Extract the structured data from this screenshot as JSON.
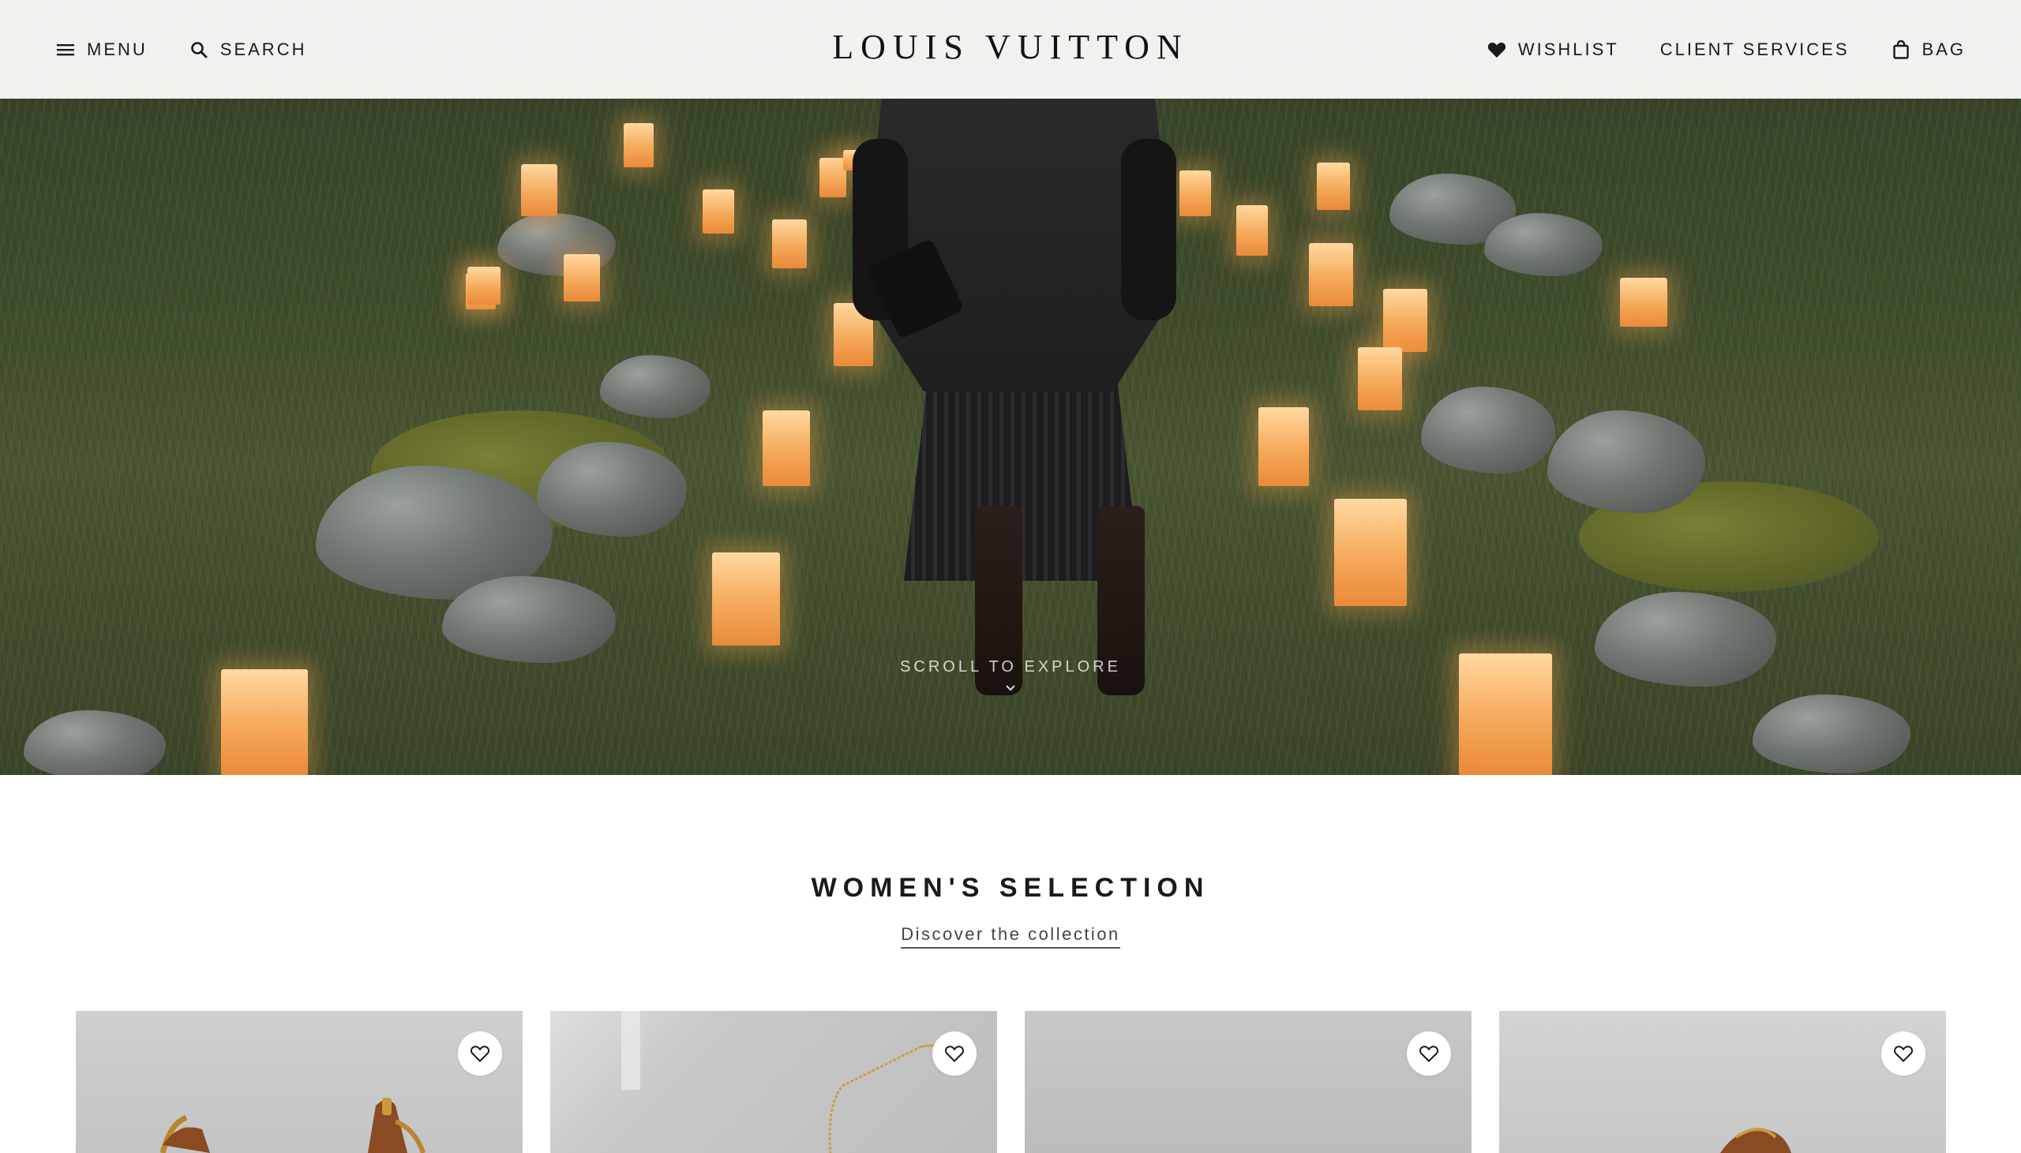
{
  "header": {
    "menu_label": "MENU",
    "search_label": "SEARCH",
    "logo": "LOUIS VUITTON",
    "wishlist_label": "WISHLIST",
    "client_services_label": "CLIENT SERVICES",
    "bag_label": "BAG"
  },
  "hero": {
    "scroll_text": "SCROLL TO EXPLORE",
    "icon": "chevron-down-icon"
  },
  "selection": {
    "title": "WOMEN'S SELECTION",
    "link": "Discover the collection",
    "products": [
      {
        "icon": "heart-outline-icon",
        "image": "handbag-with-chain"
      },
      {
        "icon": "heart-outline-icon",
        "image": "gold-necklace"
      },
      {
        "icon": "heart-outline-icon",
        "image": "product-photo"
      },
      {
        "icon": "heart-outline-icon",
        "image": "leather-bag"
      }
    ]
  },
  "colors": {
    "header_bg": "#f8f8f6",
    "text": "#1a1a1a",
    "accent": "#f5a95a"
  }
}
